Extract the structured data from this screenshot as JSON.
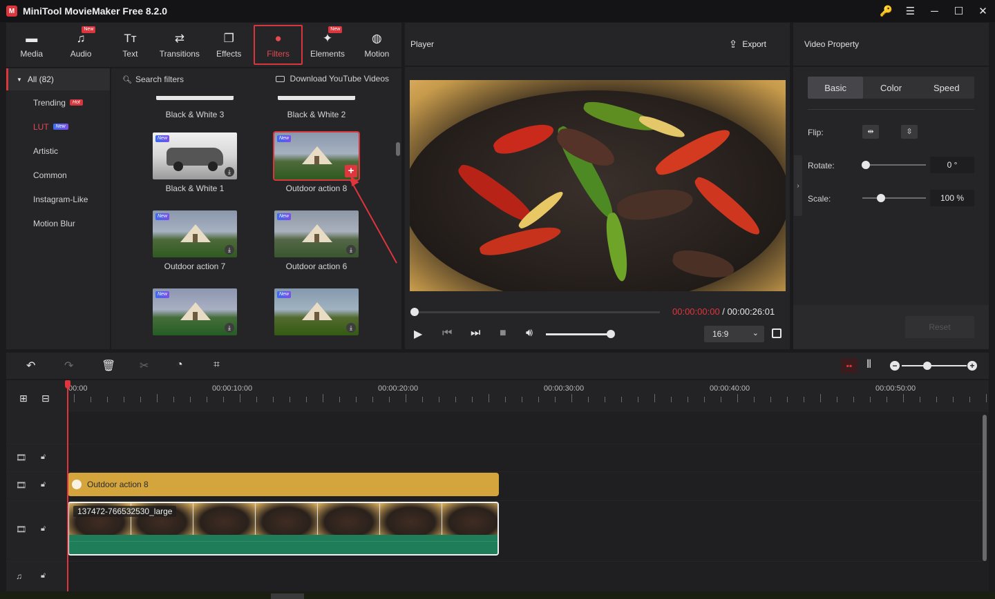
{
  "app": {
    "title": "MiniTool MovieMaker Free 8.2.0",
    "logo_text": "M"
  },
  "window_controls": [
    {
      "name": "key-icon",
      "glyph": "🔑"
    },
    {
      "name": "menu-icon",
      "glyph": "☰"
    },
    {
      "name": "minimize-icon",
      "glyph": "─"
    },
    {
      "name": "maximize-icon",
      "glyph": "☐"
    },
    {
      "name": "close-icon",
      "glyph": "✕"
    }
  ],
  "tabs": [
    {
      "label": "Media",
      "glyph": "▬",
      "new": false
    },
    {
      "label": "Audio",
      "glyph": "♫",
      "new": true
    },
    {
      "label": "Text",
      "glyph": "Tт",
      "new": false
    },
    {
      "label": "Transitions",
      "glyph": "⇄",
      "new": false
    },
    {
      "label": "Effects",
      "glyph": "❐",
      "new": false
    },
    {
      "label": "Filters",
      "glyph": "●",
      "new": false,
      "active": true
    },
    {
      "label": "Elements",
      "glyph": "✦",
      "new": true
    },
    {
      "label": "Motion",
      "glyph": "◍",
      "new": false
    }
  ],
  "new_tag": "New",
  "categories": {
    "all_label": "All (82)",
    "items": [
      {
        "label": "Trending",
        "badge": "Hot"
      },
      {
        "label": "LUT",
        "badge": "New",
        "active": true
      },
      {
        "label": "Artistic",
        "badge": ""
      },
      {
        "label": "Common",
        "badge": ""
      },
      {
        "label": "Instagram-Like",
        "badge": ""
      },
      {
        "label": "Motion Blur",
        "badge": ""
      }
    ]
  },
  "filters": {
    "search_placeholder": "Search filters",
    "youtube_label": "Download YouTube Videos",
    "items": [
      {
        "name": "Black & White 3"
      },
      {
        "name": "Black & White 2"
      },
      {
        "name": "Black & White 1",
        "tag": "New"
      },
      {
        "name": "Outdoor action 8",
        "tag": "New",
        "selected": true
      },
      {
        "name": "Outdoor action 7",
        "tag": "New"
      },
      {
        "name": "Outdoor action 6",
        "tag": "New"
      },
      {
        "name": "",
        "tag": "New"
      },
      {
        "name": "",
        "tag": "New"
      }
    ]
  },
  "player": {
    "title": "Player",
    "export_label": "Export",
    "current_time": "00:00:00:00",
    "separator": " / ",
    "total_time": "00:00:26:01",
    "aspect_ratio": "16:9",
    "progress": 0,
    "volume": 0.94
  },
  "property": {
    "title": "Video Property",
    "tabs": [
      "Basic",
      "Color",
      "Speed"
    ],
    "active_tab": "Basic",
    "flip_label": "Flip:",
    "rotate_label": "Rotate:",
    "rotate_value": "0 °",
    "scale_label": "Scale:",
    "scale_value": "100 %",
    "reset_label": "Reset"
  },
  "timeline": {
    "ruler_labels": [
      "00:00",
      "00:00:10:00",
      "00:00:20:00",
      "00:00:30:00",
      "00:00:40:00",
      "00:00:50:00"
    ],
    "filter_clip_label": "Outdoor action 8",
    "video_clip_label": "137472-766532530_large"
  },
  "colors": {
    "accent": "#d9363e",
    "panel": "#252527",
    "filter_clip": "#d4a53d",
    "video_clip": "#1f7d5a"
  }
}
